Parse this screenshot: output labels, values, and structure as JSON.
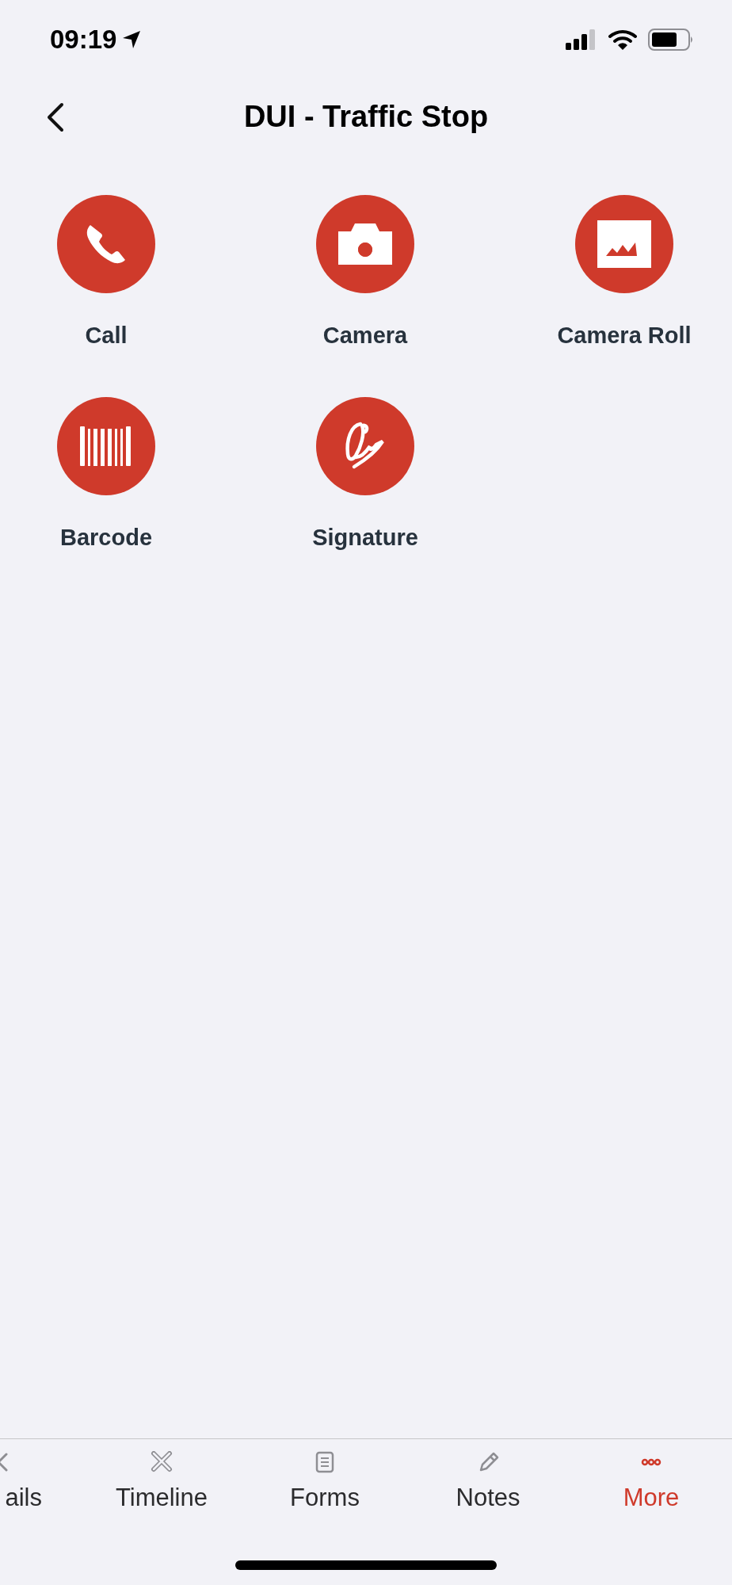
{
  "status_bar": {
    "time": "09:19"
  },
  "header": {
    "title": "DUI - Traffic Stop"
  },
  "actions": [
    {
      "kind": "phone",
      "label": "Call"
    },
    {
      "kind": "camera",
      "label": "Camera"
    },
    {
      "kind": "gallery",
      "label": "Camera Roll"
    },
    {
      "kind": "barcode",
      "label": "Barcode"
    },
    {
      "kind": "signature",
      "label": "Signature"
    }
  ],
  "tab_bar": [
    {
      "kind": "details",
      "label": "ails",
      "selected": false
    },
    {
      "kind": "timeline",
      "label": "Timeline",
      "selected": false
    },
    {
      "kind": "forms",
      "label": "Forms",
      "selected": false
    },
    {
      "kind": "notes",
      "label": "Notes",
      "selected": false
    },
    {
      "kind": "more",
      "label": "More",
      "selected": true
    }
  ]
}
